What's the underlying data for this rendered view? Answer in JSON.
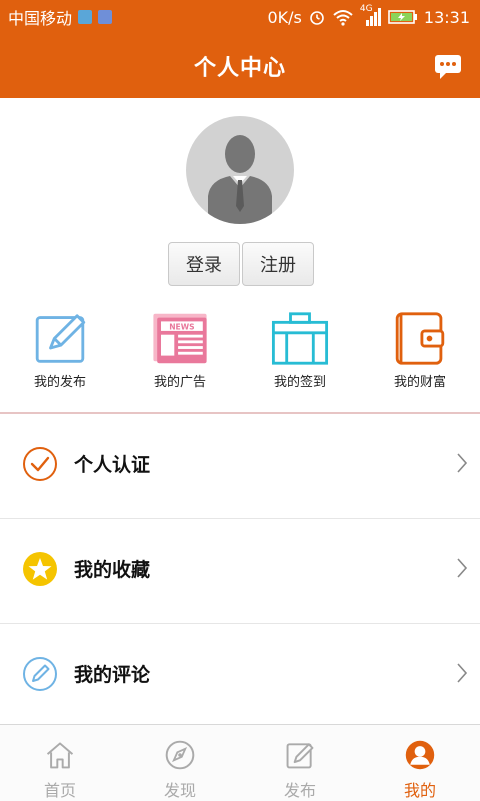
{
  "status_bar": {
    "carrier": "中国移动",
    "speed": "0K/s",
    "network": "4G",
    "time": "13:31"
  },
  "header": {
    "title": "个人中心",
    "message_icon": "chat-bubble-icon"
  },
  "profile": {
    "avatar_icon": "person-silhouette-icon",
    "login_label": "登录",
    "register_label": "注册"
  },
  "quick_actions": [
    {
      "label": "我的发布",
      "icon": "edit-icon",
      "color": "#6fb3e4"
    },
    {
      "label": "我的广告",
      "icon": "news-icon",
      "color": "#e9789b"
    },
    {
      "label": "我的签到",
      "icon": "briefcase-icon",
      "color": "#27bcd4"
    },
    {
      "label": "我的财富",
      "icon": "wallet-icon",
      "color": "#e0600e"
    }
  ],
  "menu": [
    {
      "label": "个人认证",
      "icon": "check-circle-icon",
      "color": "#e0600e"
    },
    {
      "label": "我的收藏",
      "icon": "star-circle-icon",
      "color": "#f5c400"
    },
    {
      "label": "我的评论",
      "icon": "pencil-circle-icon",
      "color": "#6fb3e4"
    }
  ],
  "tab_bar": [
    {
      "label": "首页",
      "icon": "home-icon",
      "active": false
    },
    {
      "label": "发现",
      "icon": "compass-icon",
      "active": false
    },
    {
      "label": "发布",
      "icon": "edit-icon",
      "active": false
    },
    {
      "label": "我的",
      "icon": "user-icon",
      "active": true
    }
  ],
  "colors": {
    "accent": "#e0600e",
    "divider": "#e6e6e6"
  }
}
